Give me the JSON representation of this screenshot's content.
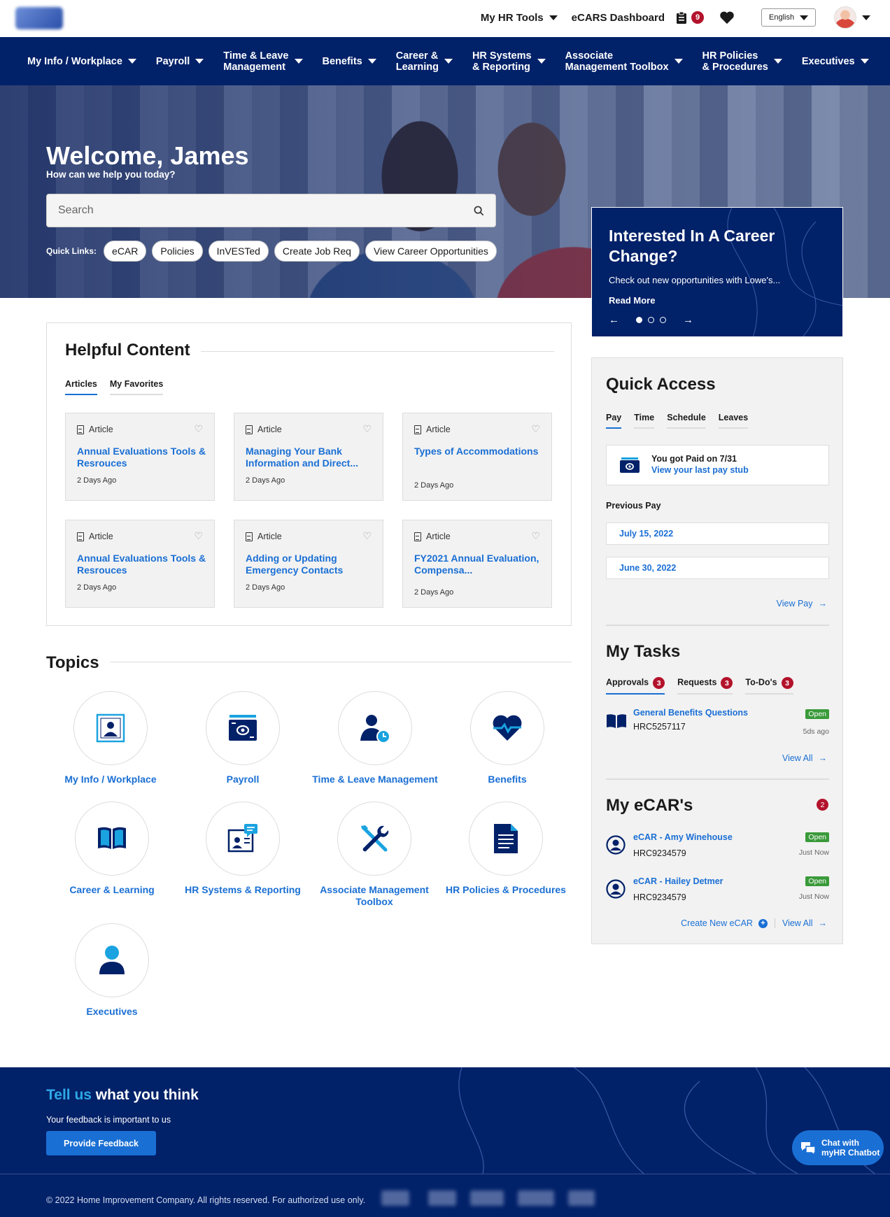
{
  "topbar": {
    "my_hr_tools": "My HR Tools",
    "ecars_dashboard": "eCARS Dashboard",
    "clipboard_count": "9",
    "language": "English"
  },
  "nav": [
    {
      "label": "My Info / Workplace"
    },
    {
      "label": "Payroll"
    },
    {
      "label": "Time & Leave\nManagement"
    },
    {
      "label": "Benefits"
    },
    {
      "label": "Career &\nLearning"
    },
    {
      "label": "HR Systems\n& Reporting"
    },
    {
      "label": "Associate\nManagement Toolbox"
    },
    {
      "label": "HR Policies\n& Procedures"
    },
    {
      "label": "Executives"
    }
  ],
  "hero": {
    "title": "Welcome, James",
    "subtitle": "How can we help you today?",
    "search_placeholder": "Search",
    "quick_links_label": "Quick Links:",
    "quick_links": [
      "eCAR",
      "Policies",
      "InVESTed",
      "Create Job Req",
      "View Career Opportunities"
    ]
  },
  "promo": {
    "title": "Interested In A Career Change?",
    "text": "Check out new opportunities with Lowe's...",
    "read_more": "Read More",
    "prev": "←",
    "next": "→"
  },
  "helpful": {
    "title": "Helpful Content",
    "tabs": [
      "Articles",
      "My Favorites"
    ],
    "cards": [
      {
        "type": "Article",
        "title": "Annual Evaluations Tools & Resrouces",
        "date": "2 Days Ago"
      },
      {
        "type": "Article",
        "title": "Managing Your Bank Information and Direct...",
        "date": "2 Days Ago"
      },
      {
        "type": "Article",
        "title": "Types of Accommodations",
        "date": "2 Days Ago"
      },
      {
        "type": "Article",
        "title": "Annual Evaluations Tools & Resrouces",
        "date": "2 Days Ago"
      },
      {
        "type": "Article",
        "title": "Adding or Updating Emergency Contacts",
        "date": "2 Days Ago"
      },
      {
        "type": "Article",
        "title": "FY2021 Annual Evaluation, Compensa...",
        "date": "2 Days Ago"
      }
    ]
  },
  "topics": {
    "title": "Topics",
    "items": [
      {
        "label": "My Info / Workplace"
      },
      {
        "label": "Payroll"
      },
      {
        "label": "Time & Leave Management"
      },
      {
        "label": "Benefits"
      },
      {
        "label": "Career & Learning"
      },
      {
        "label": "HR Systems & Reporting"
      },
      {
        "label": "Associate Management Toolbox"
      },
      {
        "label": "HR Policies & Procedures"
      },
      {
        "label": "Executives"
      }
    ]
  },
  "quick_access": {
    "title": "Quick Access",
    "tabs": [
      "Pay",
      "Time",
      "Schedule",
      "Leaves"
    ],
    "paid_text": "You got Paid on 7/31",
    "pay_stub_link": "View your last pay stub",
    "previous_pay_label": "Previous Pay",
    "previous_pay": [
      "July 15, 2022",
      "June 30, 2022"
    ],
    "view_pay": "View Pay"
  },
  "my_tasks": {
    "title": "My Tasks",
    "tabs": [
      {
        "label": "Approvals",
        "count": "3"
      },
      {
        "label": "Requests",
        "count": "3"
      },
      {
        "label": "To-Do's",
        "count": "3"
      }
    ],
    "items": [
      {
        "title": "General Benefits Questions",
        "id": "HRC5257117",
        "status": "Open",
        "time": "5ds ago"
      }
    ],
    "view_all": "View All"
  },
  "my_ecars": {
    "title": "My eCAR's",
    "count": "2",
    "items": [
      {
        "title": "eCAR - Amy Winehouse",
        "id": "HRC9234579",
        "status": "Open",
        "time": "Just Now"
      },
      {
        "title": "eCAR - Hailey Detmer",
        "id": "HRC9234579",
        "status": "Open",
        "time": "Just Now"
      }
    ],
    "create_new": "Create New eCAR",
    "view_all": "View All"
  },
  "footer": {
    "title_accent": "Tell us",
    "title_rest": " what you think",
    "subtitle": "Your feedback is important to us",
    "button": "Provide Feedback",
    "copyright": "© 2022 Home Improvement Company. All rights reserved. For authorized use only."
  },
  "chatbot": {
    "label": "Chat with\nmyHR Chatbot"
  },
  "colors": {
    "brand_navy": "#012169",
    "link_blue": "#1a6fd4",
    "alert_red": "#b3122b",
    "status_green": "#3a9a3a",
    "accent_cyan": "#2ea8e6"
  }
}
